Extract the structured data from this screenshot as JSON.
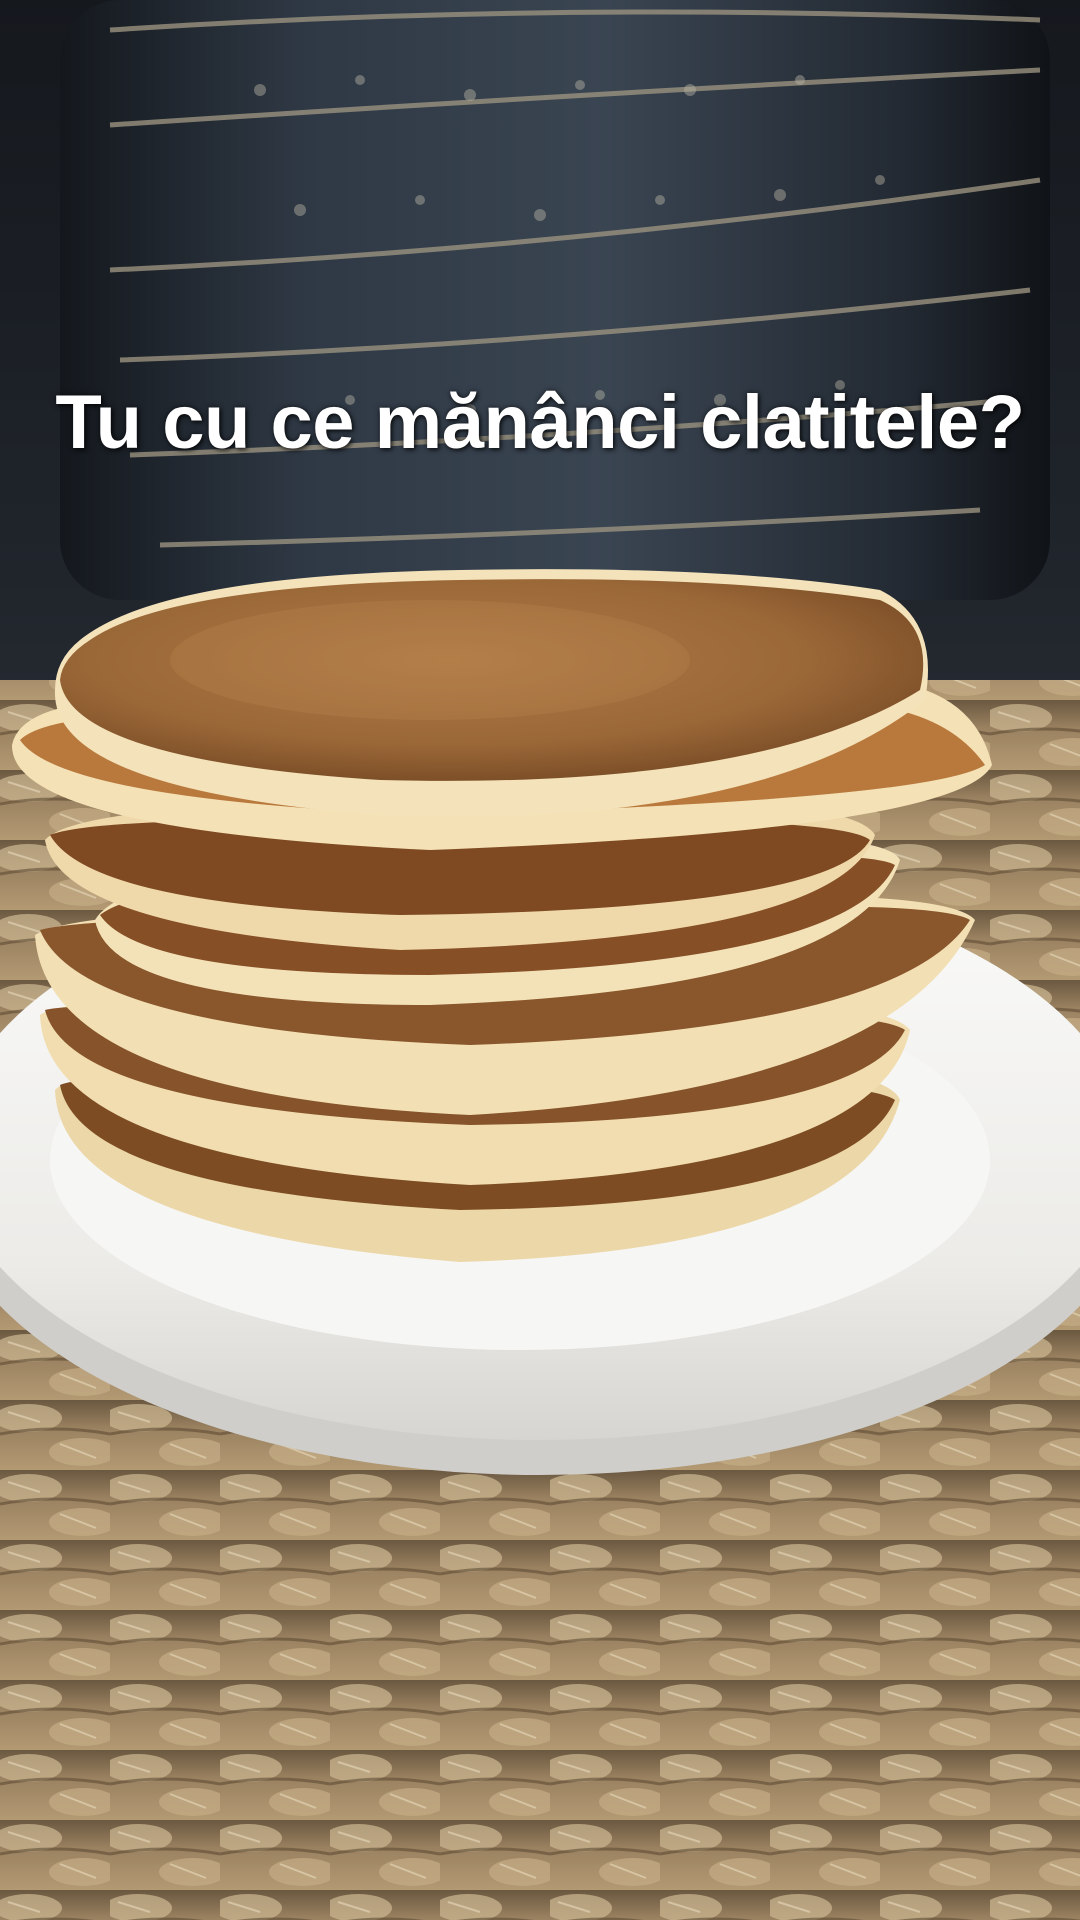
{
  "overlay": {
    "caption": "Tu cu ce mănânci clatitele?"
  },
  "scene": {
    "subjects": [
      "pot-icon",
      "plate-icon",
      "pancake-stack-icon",
      "woven-placemat-icon"
    ]
  },
  "colors": {
    "pot": "#2b323c",
    "pot_stripe": "#8c8578",
    "plate": "#f3f3f1",
    "pancake_top": "#9c6a3c",
    "pancake_edge": "#f0dcae",
    "pancake_shadow": "#7a4c26",
    "mat": "#a58a63",
    "mat_light": "#d8c6a4",
    "caption_text": "#ffffff"
  }
}
